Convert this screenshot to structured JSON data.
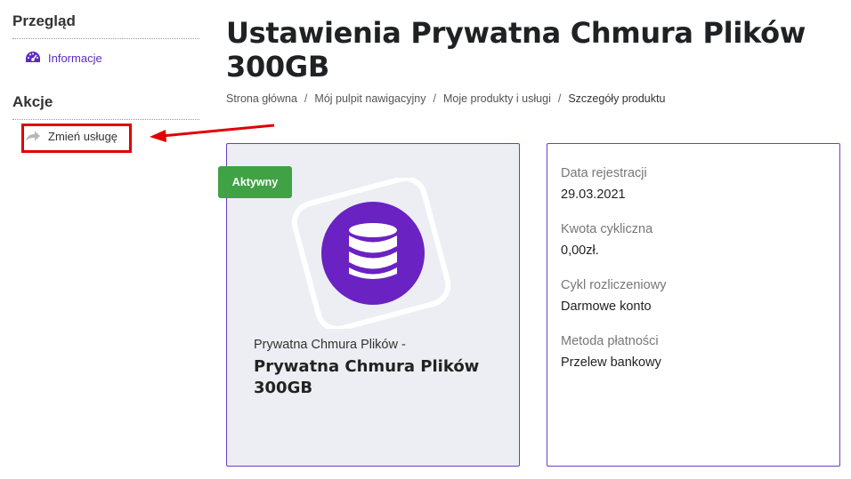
{
  "sidebar": {
    "overview_heading": "Przegląd",
    "overview_items": [
      {
        "label": "Informacje",
        "icon": "dashboard-icon"
      }
    ],
    "actions_heading": "Akcje",
    "action_items": [
      {
        "label": "Zmień usługę",
        "icon": "share-arrow-icon"
      }
    ]
  },
  "page": {
    "title": "Ustawienia Prywatna Chmura Plików 300GB",
    "breadcrumb": [
      "Strona główna",
      "Mój pulpit nawigacyjny",
      "Moje produkty i usługi",
      "Szczegóły produktu"
    ]
  },
  "product": {
    "status": "Aktywny",
    "group": "Prywatna Chmura Plików -",
    "name": "Prywatna Chmura Plików 300GB",
    "icon": "database-icon"
  },
  "details": [
    {
      "label": "Data rejestracji",
      "value": "29.03.2021"
    },
    {
      "label": "Kwota cykliczna",
      "value": "0,00zł."
    },
    {
      "label": "Cykl rozliczeniowy",
      "value": "Darmowe konto"
    },
    {
      "label": "Metoda płatności",
      "value": "Przelew bankowy"
    }
  ],
  "colors": {
    "accent": "#5b2bbf",
    "status_green": "#3fa244",
    "annotation_red": "#e00000",
    "card_bg": "#eceef3"
  }
}
